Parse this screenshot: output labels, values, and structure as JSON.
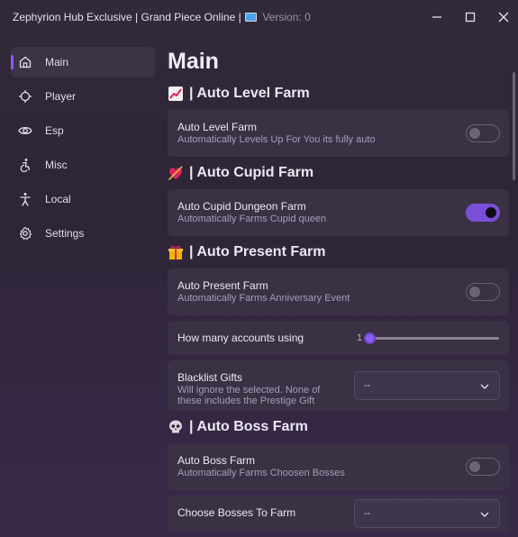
{
  "window": {
    "title": "Zephyrion Hub Exclusive | Grand Piece Online |",
    "version": "Version: 0"
  },
  "sidebar": {
    "items": [
      {
        "label": "Main",
        "icon": "home-icon",
        "active": true
      },
      {
        "label": "Player",
        "icon": "crosshair-icon"
      },
      {
        "label": "Esp",
        "icon": "eye-icon"
      },
      {
        "label": "Misc",
        "icon": "accessibility-icon"
      },
      {
        "label": "Local",
        "icon": "person-icon"
      },
      {
        "label": "Settings",
        "icon": "gear-icon"
      }
    ]
  },
  "main": {
    "title": "Main",
    "sections": [
      {
        "emoji": "chart-increasing-icon",
        "label": "| Auto Level Farm",
        "cards": [
          {
            "title": "Auto Level Farm",
            "desc": "Automatically Levels Up For You its fully auto",
            "toggle": false
          }
        ]
      },
      {
        "emoji": "heart-with-arrow-icon",
        "label": "| Auto Cupid Farm",
        "cards": [
          {
            "title": "Auto Cupid Dungeon Farm",
            "desc": "Automatically Farms Cupid queen",
            "toggle": true
          }
        ]
      },
      {
        "emoji": "wrapped-gift-icon",
        "label": "| Auto Present Farm",
        "cards": [
          {
            "title": "Auto Present Farm",
            "desc": "Automatically Farms Anniversary Event",
            "toggle": false
          },
          {
            "title": "How many accounts using",
            "slider_value": "1"
          },
          {
            "title": "Blacklist Gifts",
            "desc_lines": [
              "Will ignore the selected. None of",
              "these includes the Prestige Gift"
            ],
            "dropdown_value": "--"
          }
        ]
      },
      {
        "emoji": "skull-icon",
        "label": "| Auto Boss Farm",
        "cards": [
          {
            "title": "Auto Boss Farm",
            "desc": "Automatically Farms Choosen Bosses",
            "toggle": false
          },
          {
            "title": "Choose Bosses To Farm",
            "dropdown_value": "--"
          }
        ]
      }
    ]
  },
  "colors": {
    "accent": "#8b5cf6",
    "toggle_on": "#7a4fd8"
  }
}
